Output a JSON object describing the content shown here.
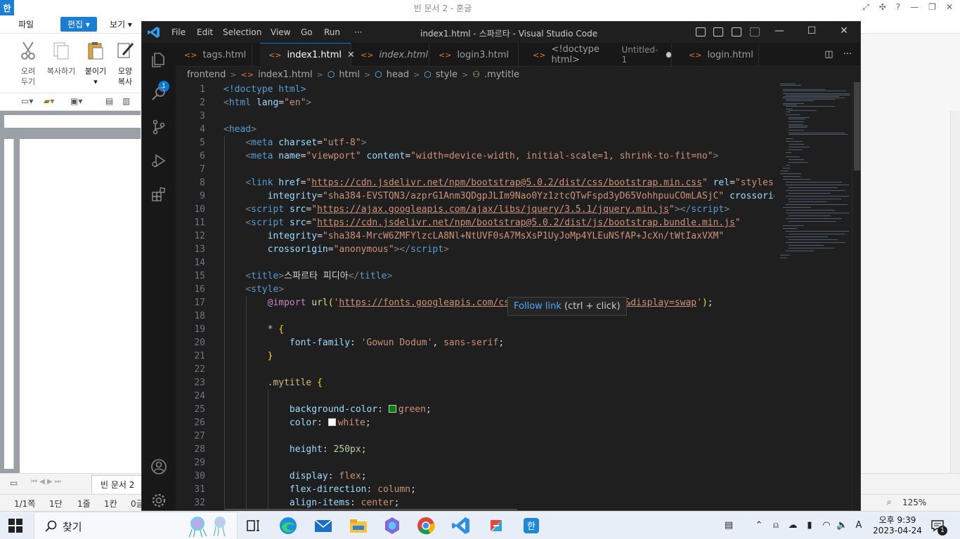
{
  "hwp": {
    "logo": "한",
    "title": "빈 문서 2 - 훈글",
    "menus": [
      "파일",
      "편집",
      "보기"
    ],
    "tools": [
      {
        "label1": "오려",
        "label2": "두기"
      },
      {
        "label1": "복사하기",
        "label2": ""
      },
      {
        "label1": "붙이기",
        "label2": ""
      },
      {
        "label1": "모양",
        "label2": "복사"
      }
    ],
    "doc_tab": "빈 문서 2",
    "status": {
      "page": "1/1쪽",
      "section": "1단",
      "line": "1줄",
      "column": "1칸",
      "misc": "0글"
    },
    "zoom": "125%"
  },
  "vscode": {
    "window_title": "index1.html - 스파르타 - Visual Studio Code",
    "menus": [
      "File",
      "Edit",
      "Selection",
      "View",
      "Go",
      "Run",
      "···"
    ],
    "explorer_badge": "1",
    "tabs": [
      {
        "label": "tags.html",
        "active": false
      },
      {
        "label": "index1.html",
        "active": true
      },
      {
        "label": "index.html",
        "active": false,
        "italic": true
      },
      {
        "label": "login3.html",
        "active": false
      },
      {
        "label": "<!doctype html>",
        "sub": "Untitled-1",
        "dirty": true
      },
      {
        "label": "login.html",
        "active": false
      }
    ],
    "breadcrumb": [
      "frontend",
      "index1.html",
      "html",
      "head",
      "style",
      ".mytitle"
    ],
    "hover": {
      "link": "Follow link",
      "hint": " (ctrl + click)"
    },
    "line_numbers": [
      "1",
      "2",
      "3",
      "4",
      "5",
      "6",
      "7",
      "8",
      "9",
      "10",
      "11",
      "12",
      "13",
      "14",
      "15",
      "16",
      "17",
      "18",
      "19",
      "20",
      "21",
      "22",
      "23",
      "24",
      "25",
      "26",
      "27",
      "28",
      "29",
      "30",
      "31",
      "32"
    ],
    "code": {
      "l1_doctype": "<!doctype html>",
      "l2_html": "html",
      "l2_attr": "lang",
      "l2_val": "\"en\"",
      "l4_head": "head",
      "l5_meta": "meta",
      "l5_attr": "charset",
      "l5_val": "\"utf-8\"",
      "l6_meta": "meta",
      "l6_a1": "name",
      "l6_v1": "\"viewport\"",
      "l6_a2": "content",
      "l6_v2": "\"width=device-width, initial-scale=1, shrink-to-fit=no\"",
      "l8_link": "link",
      "l8_a1": "href",
      "l8_q": "\"",
      "l8_url": "https://cdn.jsdelivr.net/npm/bootstrap@5.0.2/dist/css/bootstrap.min.css",
      "l8_a2": "rel",
      "l8_v2": "\"styleshe",
      "l9_a1": "integrity",
      "l9_v1": "\"sha384-EVSTQN3/azprG1Anm3QDgpJLIm9Nao0Yz1ztcQTwFspd3yD65VohhpuuCOmLASjC\"",
      "l9_a2": "crossorigi",
      "l10_tag": "script",
      "l10_a": "src",
      "l10_url": "https://ajax.googleapis.com/ajax/libs/jquery/3.5.1/jquery.min.js",
      "l10_end": "script",
      "l11_tag": "script",
      "l11_a": "src",
      "l11_url": "https://cdn.jsdelivr.net/npm/bootstrap@5.0.2/dist/js/bootstrap.bundle.min.js",
      "l12_a": "integrity",
      "l12_v": "\"sha384-MrcW6ZMFYlzcLA8Nl+NtUVF0sA7MsXsP1UyJoMp4YLEuNSfAP+JcXn/tWtIaxVXM\"",
      "l13_a": "crossorigin",
      "l13_v": "\"anonymous\"",
      "l13_end": "script",
      "l15_tag": "title",
      "l15_text": "스파르타 피디아",
      "l15_end": "title",
      "l16_tag": "style",
      "l17_kw": "@import",
      "l17_fn": "url",
      "l17_url": "https://fonts.googleapis.com/css2?family=Gowun+Dodum&display=swap",
      "l19_sel": "*",
      "l20_prop": "font-family",
      "l20_v1": "'Gowun Dodum'",
      "l20_v2": "sans-serif",
      "l23_sel": ".mytitle",
      "l25_prop": "background-color",
      "l25_val": "green",
      "l26_prop": "color",
      "l26_val": "white",
      "l28_prop": "height",
      "l28_val": "250px",
      "l30_prop": "display",
      "l30_val": "flex",
      "l31_prop": "flex-direction",
      "l31_val": "column",
      "l32_prop": "align-items",
      "l32_val": "center"
    }
  },
  "colors": {
    "swatch_green": "#008000",
    "swatch_white": "#ffffff",
    "accent": "#0078d4"
  },
  "taskbar": {
    "search_label": "찾기",
    "apps": [
      "task-view",
      "edge",
      "mail",
      "file-explorer",
      "copilot",
      "chrome",
      "vscode",
      "hwp-pdf",
      "hangul"
    ],
    "clock_time": "오후 9:39",
    "clock_date": "2023-04-24",
    "notification_count": "1"
  }
}
